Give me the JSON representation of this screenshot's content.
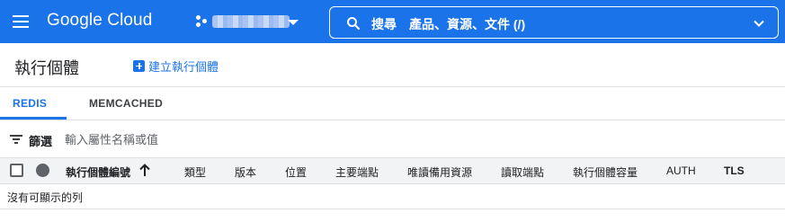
{
  "topbar": {
    "logo": "Google Cloud",
    "search_label": "搜尋",
    "search_hint": "產品、資源、文件 (/)"
  },
  "page": {
    "title": "執行個體",
    "create_button": "建立執行個體"
  },
  "tabs": [
    {
      "label": "REDIS",
      "active": true
    },
    {
      "label": "MEMCACHED",
      "active": false
    }
  ],
  "filter": {
    "label": "篩選",
    "placeholder": "輸入屬性名稱或值"
  },
  "table": {
    "columns": [
      "執行個體編號",
      "類型",
      "版本",
      "位置",
      "主要端點",
      "唯讀備用資源",
      "讀取端點",
      "執行個體容量",
      "AUTH",
      "TLS"
    ],
    "empty_message": "沒有可顯示的列"
  },
  "colors": {
    "accent": "#1a73e8",
    "header_bg": "#f1f3f4"
  }
}
